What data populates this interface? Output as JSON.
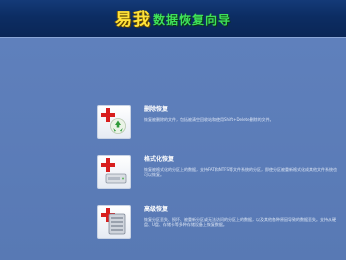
{
  "header": {
    "brand": "易我",
    "subtitle": "数据恢复向导"
  },
  "options": [
    {
      "title": "删除恢复",
      "desc": "恢复被删除的文件，包括被清空回收站和使用Shift+Delete删除的文件。",
      "icon": "recycle-bin-icon"
    },
    {
      "title": "格式化恢复",
      "desc": "恢复被格式化的分区上的数据，支持FAT和NTFS等文件系统的分区，即使分区被重新格式化成其他文件系统也可以恢复。",
      "icon": "drive-icon"
    },
    {
      "title": "高级恢复",
      "desc": "恢复分区丢失、损坏、被重新分区或无法访问的分区上的数据，以及其他各种原因导致的数据丢失。支持从硬盘、U盘、存储卡等多种存储设备上恢复数据。",
      "icon": "hard-disk-icon"
    }
  ],
  "colors": {
    "background": "#5b7bb6",
    "header": "#0c2d63",
    "brand": "#ffe23a",
    "subtitle": "#3ee05a",
    "plus": "#d81e1e"
  }
}
